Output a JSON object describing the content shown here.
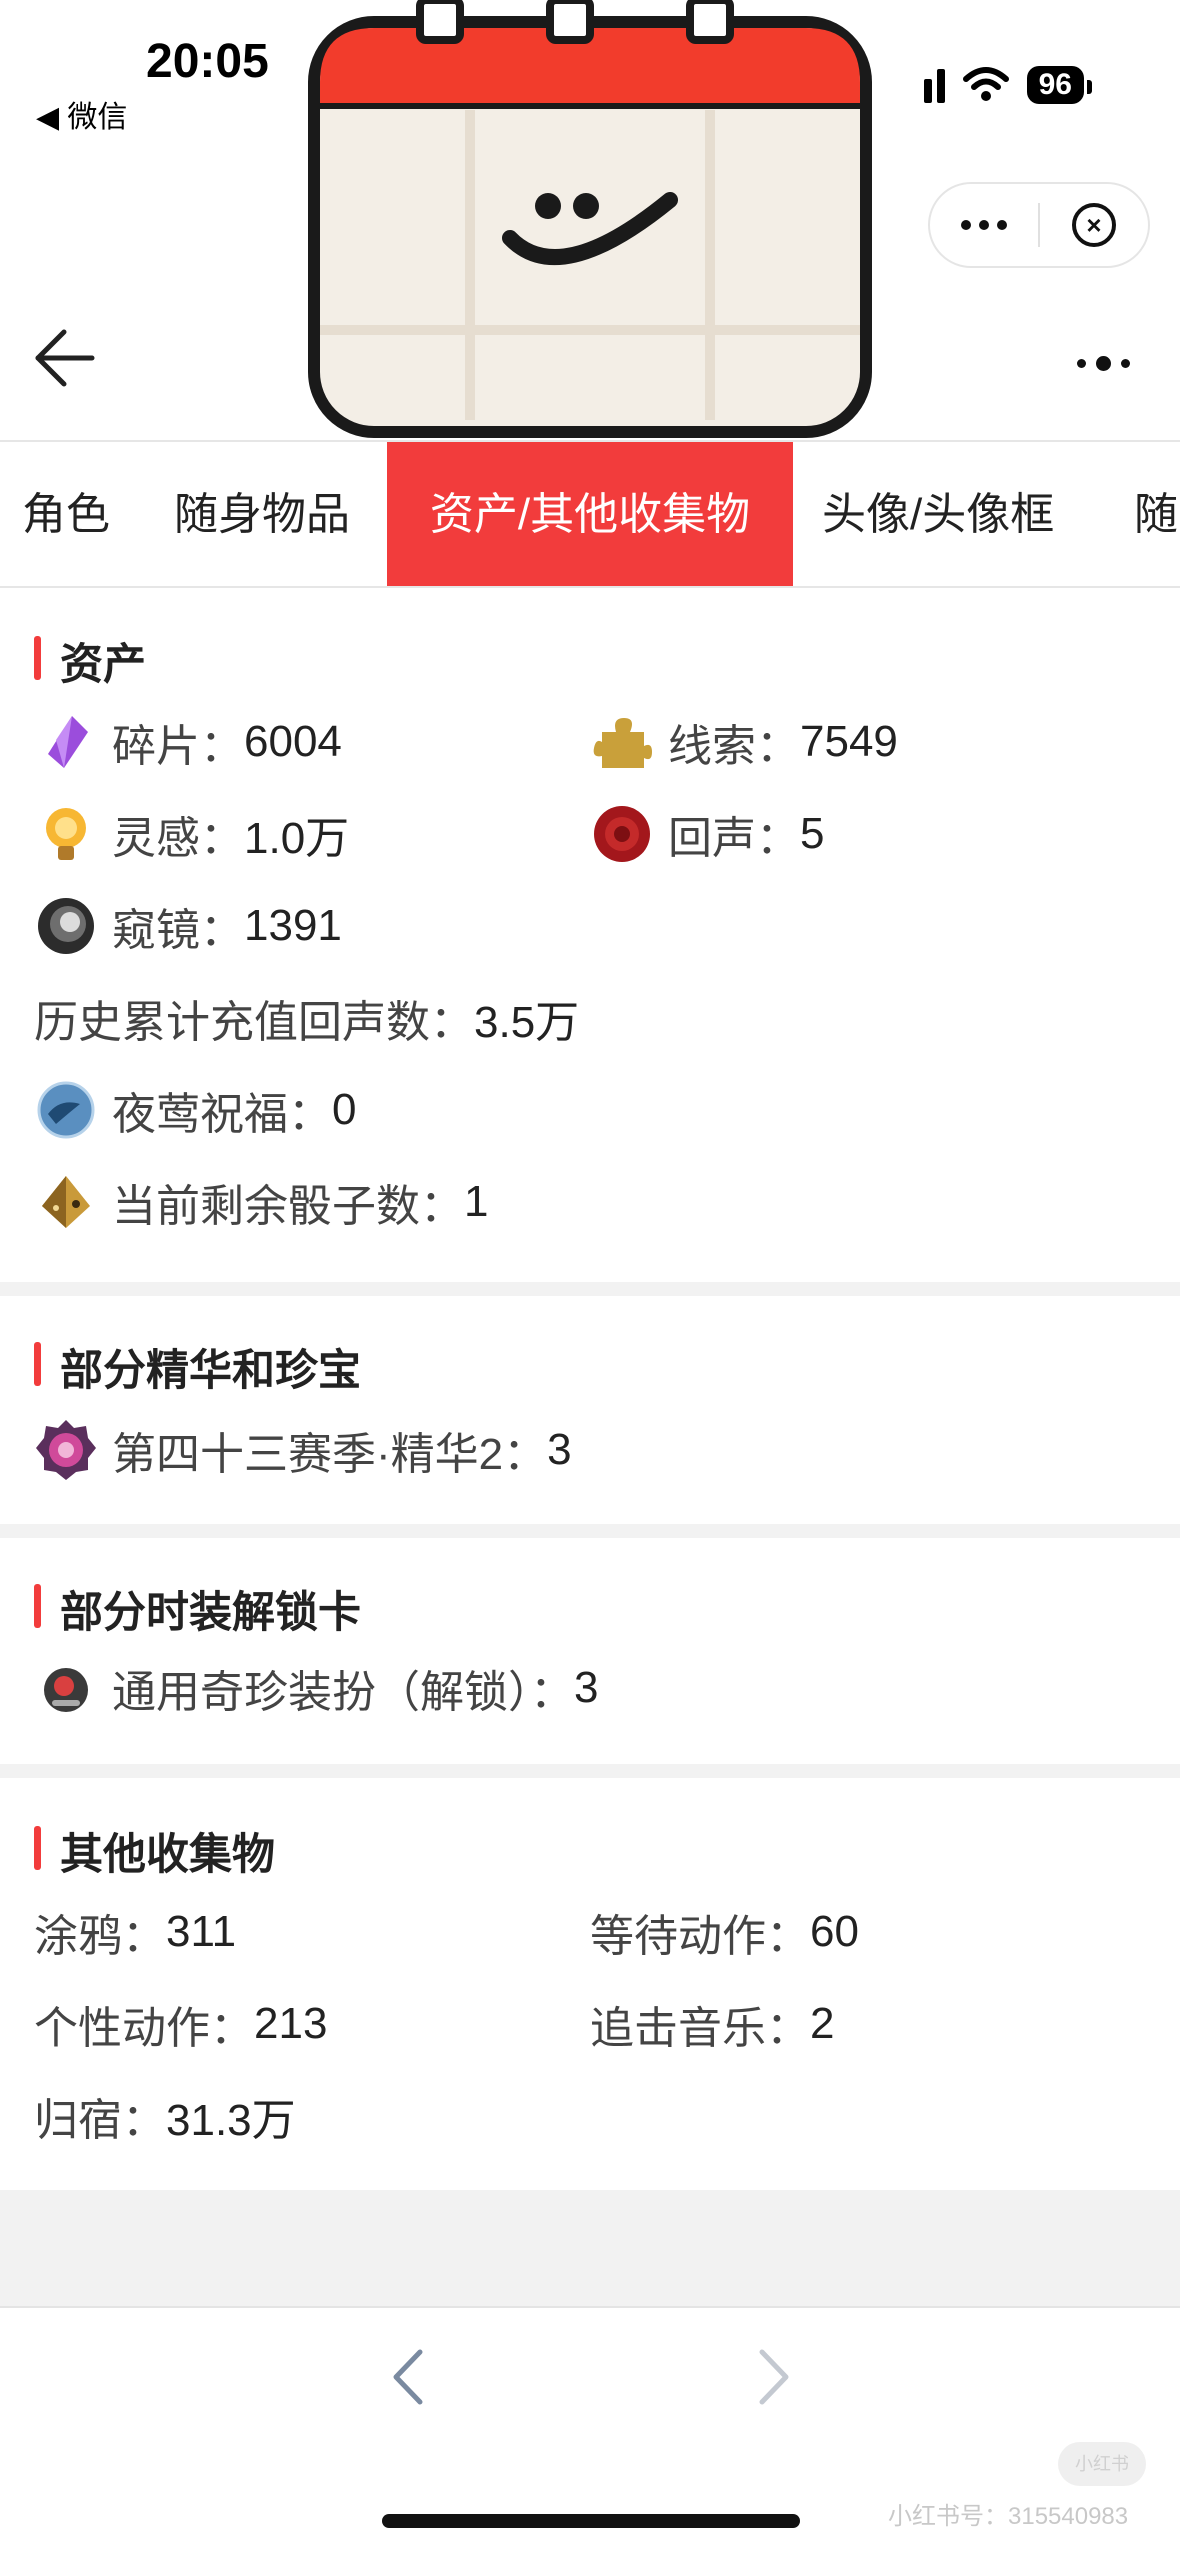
{
  "status_bar": {
    "time": "20:05",
    "back_app": "◀ 微信",
    "battery": "96"
  },
  "tabs": [
    {
      "label": "角色"
    },
    {
      "label": "随身物品"
    },
    {
      "label": "资产/其他收集物",
      "active": true
    },
    {
      "label": "头像/头像框"
    },
    {
      "label": "随"
    }
  ],
  "sections": {
    "assets": {
      "title": "资产",
      "items": [
        {
          "label": "碎片：",
          "value": "6004",
          "icon": "purple-crystal-icon"
        },
        {
          "label": "线索：",
          "value": "7549",
          "icon": "gold-puzzle-piece-icon"
        },
        {
          "label": "灵感：",
          "value": "1.0万",
          "icon": "lightbulb-icon"
        },
        {
          "label": "回声：",
          "value": "5",
          "icon": "red-wax-seal-icon"
        },
        {
          "label": "窥镜：",
          "value": "1391",
          "icon": "lens-icon"
        },
        {
          "label": "历史累计充值回声数：",
          "value": "3.5万"
        },
        {
          "label": "夜莺祝福：",
          "value": "0",
          "icon": "blue-orb-icon"
        },
        {
          "label": "当前剩余骰子数：",
          "value": "1",
          "icon": "golden-dice-icon"
        }
      ]
    },
    "essence": {
      "title": "部分精华和珍宝",
      "items": [
        {
          "label": "第四十三赛季·精华2：",
          "value": "3",
          "icon": "pink-essence-badge-icon"
        }
      ]
    },
    "costume_cards": {
      "title": "部分时装解锁卡",
      "items": [
        {
          "label": "通用奇珍装扮（解锁）：",
          "value": "3",
          "icon": "costume-card-icon"
        }
      ]
    },
    "other": {
      "title": "其他收集物",
      "items": [
        {
          "label": "涂鸦：",
          "value": "311"
        },
        {
          "label": "等待动作：",
          "value": "60"
        },
        {
          "label": "个性动作：",
          "value": "213"
        },
        {
          "label": "追击音乐：",
          "value": "2"
        },
        {
          "label": "归宿：",
          "value": "31.3万"
        }
      ]
    }
  },
  "watermark": {
    "text": "小红书号：315540983",
    "logo": "小红书"
  },
  "colors": {
    "accent": "#f23c3c",
    "divider": "#f2f2f2"
  }
}
